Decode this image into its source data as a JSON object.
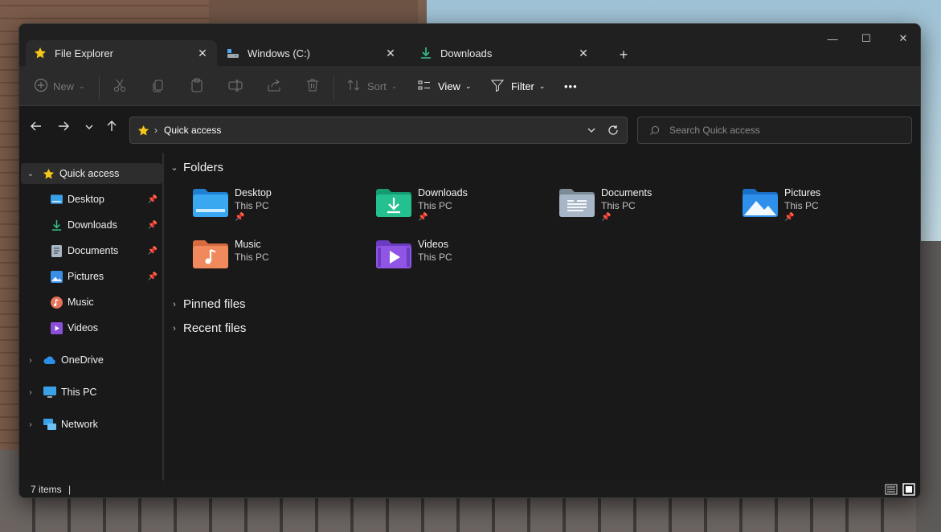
{
  "tabs": [
    {
      "label": "File Explorer",
      "icon": "star-icon",
      "active": true
    },
    {
      "label": "Windows (C:)",
      "icon": "drive-icon",
      "active": false
    },
    {
      "label": "Downloads",
      "icon": "download-icon",
      "active": false
    }
  ],
  "new_tab_label": "+",
  "window_controls": {
    "minimize": "—",
    "maximize": "☐",
    "close": "✕"
  },
  "toolbar": {
    "new_label": "New",
    "sort_label": "Sort",
    "view_label": "View",
    "filter_label": "Filter",
    "more_label": "•••"
  },
  "address": {
    "crumb_sep": "›",
    "location": "Quick access"
  },
  "search": {
    "placeholder": "Search Quick access"
  },
  "sidebar": {
    "quick_access": "Quick access",
    "items": [
      {
        "label": "Desktop",
        "icon": "desktop-folder-icon",
        "pinned": true
      },
      {
        "label": "Downloads",
        "icon": "download-icon",
        "pinned": true
      },
      {
        "label": "Documents",
        "icon": "documents-icon",
        "pinned": true
      },
      {
        "label": "Pictures",
        "icon": "pictures-icon",
        "pinned": true
      },
      {
        "label": "Music",
        "icon": "music-icon",
        "pinned": false
      },
      {
        "label": "Videos",
        "icon": "videos-icon",
        "pinned": false
      }
    ],
    "onedrive": "OneDrive",
    "thispc": "This PC",
    "network": "Network"
  },
  "sections": {
    "folders": "Folders",
    "pinned_files": "Pinned files",
    "recent_files": "Recent files"
  },
  "folders": [
    {
      "name": "Desktop",
      "location": "This PC",
      "pinned": true
    },
    {
      "name": "Downloads",
      "location": "This PC",
      "pinned": true
    },
    {
      "name": "Documents",
      "location": "This PC",
      "pinned": true
    },
    {
      "name": "Pictures",
      "location": "This PC",
      "pinned": true
    },
    {
      "name": "Music",
      "location": "This PC",
      "pinned": false
    },
    {
      "name": "Videos",
      "location": "This PC",
      "pinned": false
    }
  ],
  "status": {
    "item_count": "7 items",
    "separator": "|"
  },
  "colors": {
    "accent_star": "#f5c518",
    "window_bg": "#191919",
    "toolbar_bg": "#2b2b2b"
  }
}
